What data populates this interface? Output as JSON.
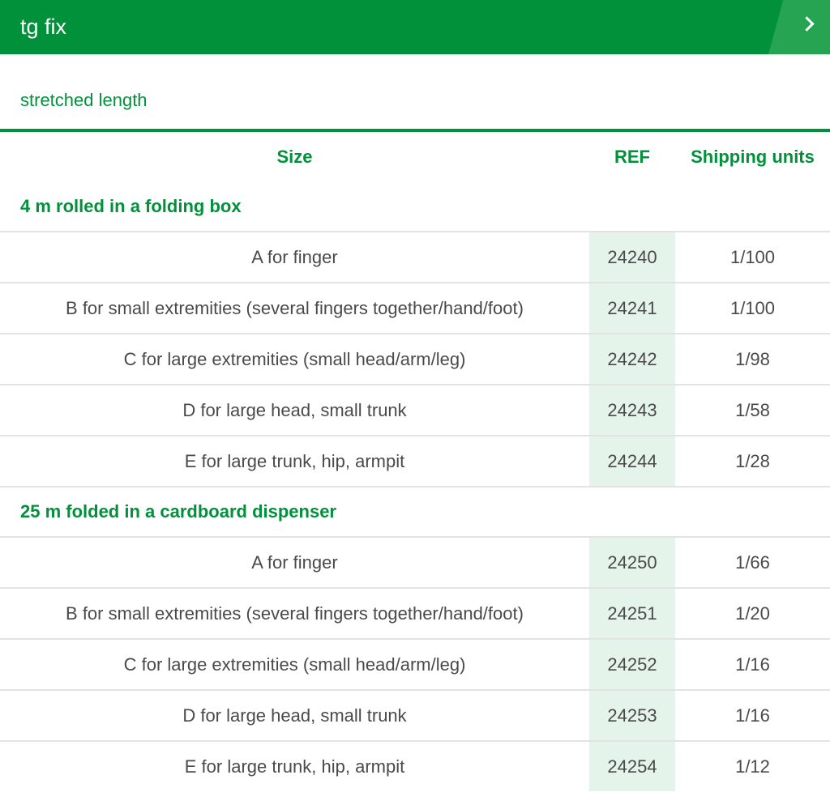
{
  "header": {
    "title": "tg fix"
  },
  "subtitle": "stretched length",
  "table": {
    "columns": [
      "Size",
      "REF",
      "Shipping units"
    ],
    "groups": [
      {
        "title": "4 m rolled in a folding box",
        "rows": [
          {
            "size": "A for finger",
            "ref": "24240",
            "units": "1/100"
          },
          {
            "size": "B for small extremities (several fingers together/hand/foot)",
            "ref": "24241",
            "units": "1/100"
          },
          {
            "size": "C for large extremities (small head/arm/leg)",
            "ref": "24242",
            "units": "1/98"
          },
          {
            "size": "D for large head, small trunk",
            "ref": "24243",
            "units": "1/58"
          },
          {
            "size": "E for large trunk, hip, armpit",
            "ref": "24244",
            "units": "1/28"
          }
        ]
      },
      {
        "title": "25 m folded in a cardboard dispenser",
        "rows": [
          {
            "size": "A for finger",
            "ref": "24250",
            "units": "1/66"
          },
          {
            "size": "B for small extremities (several fingers together/hand/foot)",
            "ref": "24251",
            "units": "1/20"
          },
          {
            "size": "C for large extremities (small head/arm/leg)",
            "ref": "24252",
            "units": "1/16"
          },
          {
            "size": "D for large head, small trunk",
            "ref": "24253",
            "units": "1/16"
          },
          {
            "size": "E for large trunk, hip, armpit",
            "ref": "24254",
            "units": "1/12"
          }
        ]
      }
    ]
  },
  "colors": {
    "brand_green": "#00913a",
    "ref_column_bg": "#e5f4ea",
    "text_gray": "#4a4a4a"
  },
  "icons": {
    "expand": "chevron-right-icon"
  }
}
